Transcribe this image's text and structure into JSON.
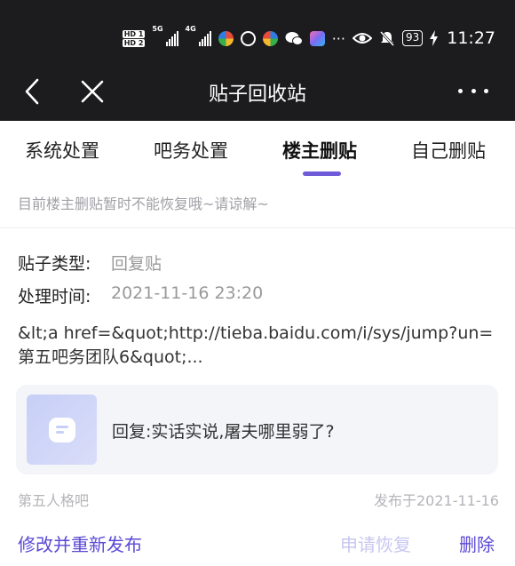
{
  "status_bar": {
    "hd1": "HD 1",
    "hd2": "HD 2",
    "network1": "5G",
    "network2": "4G",
    "battery": "93",
    "time": "11:27",
    "icons": [
      "signal-icon",
      "app-icon",
      "circle-icon",
      "app-icon",
      "wechat-icon",
      "app-icon",
      "more-dots-icon",
      "eye-icon",
      "mute-icon",
      "battery-icon",
      "charging-icon"
    ]
  },
  "navbar": {
    "title": "贴子回收站",
    "back_icon": "chevron-left-icon",
    "close_icon": "close-icon",
    "more_icon": "more-dots-icon"
  },
  "tabs": [
    {
      "label": "系统处置",
      "active": false
    },
    {
      "label": "吧务处置",
      "active": false
    },
    {
      "label": "楼主删贴",
      "active": true
    },
    {
      "label": "自己删贴",
      "active": false
    }
  ],
  "accent_color": "#5a4ad6",
  "notice": "目前楼主删贴暂时不能恢复哦~请谅解~",
  "post": {
    "type_label": "贴子类型:",
    "type_value": "回复贴",
    "time_label": "处理时间:",
    "time_value": "2021-11-16 23:20",
    "content_line1": "&lt;a href=&quot;http://tieba.baidu.com/i/sys/jump?un=",
    "content_line2": "第五吧务团队6&quot;...",
    "quote": "回复:实话实说,屠夫哪里弱了?",
    "forum": "第五人格吧",
    "published": "发布于2021-11-16"
  },
  "actions": {
    "edit": "修改并重新发布",
    "restore": "申请恢复",
    "delete": "删除"
  }
}
